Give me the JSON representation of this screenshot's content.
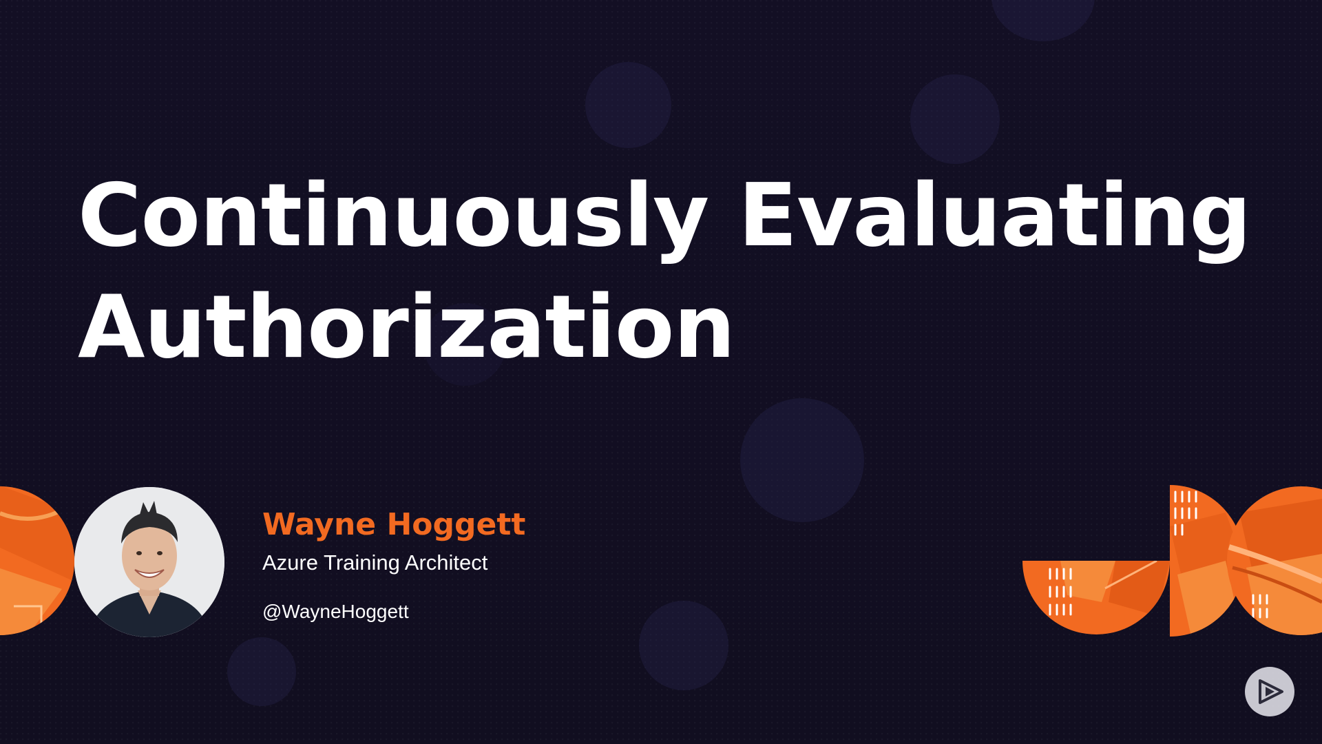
{
  "slide": {
    "title_line_1": "Continuously Evaluating",
    "title_line_2": "Authorization"
  },
  "speaker": {
    "name": "Wayne Hoggett",
    "role": "Azure Training Architect",
    "handle": "@WayneHoggett"
  },
  "colors": {
    "background": "#120f22",
    "accent_orange": "#f26a21",
    "title_text": "#ffffff"
  },
  "icons": {
    "player_logo": "play-logo-icon",
    "avatar": "speaker-photo"
  }
}
